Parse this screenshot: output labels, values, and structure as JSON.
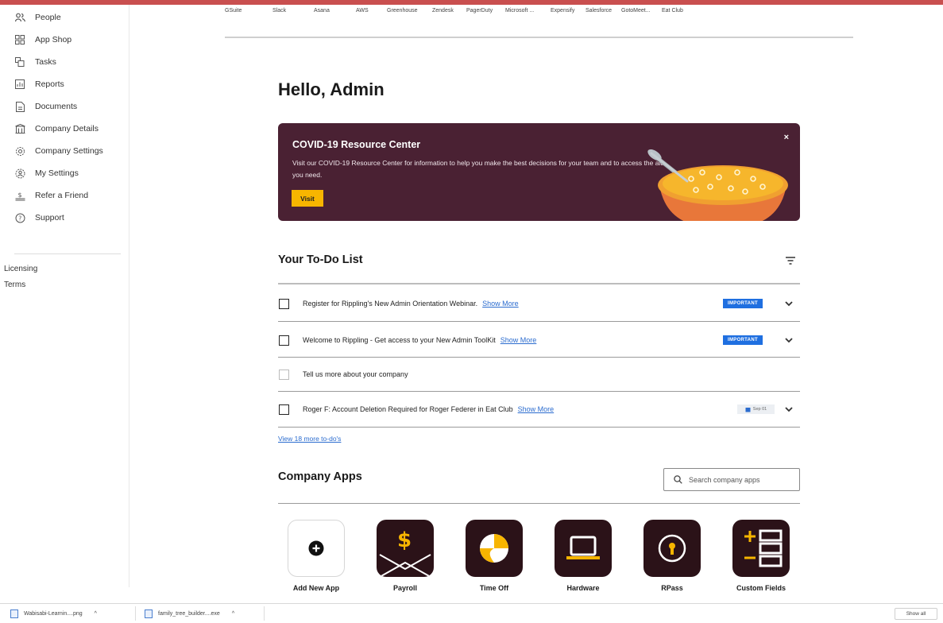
{
  "sidebar": {
    "items": [
      {
        "label": "People",
        "icon": "people-icon"
      },
      {
        "label": "App Shop",
        "icon": "grid-icon"
      },
      {
        "label": "Tasks",
        "icon": "tasks-icon"
      },
      {
        "label": "Reports",
        "icon": "reports-icon"
      },
      {
        "label": "Documents",
        "icon": "document-icon"
      },
      {
        "label": "Company Details",
        "icon": "building-icon"
      },
      {
        "label": "Company Settings",
        "icon": "gear-icon"
      },
      {
        "label": "My Settings",
        "icon": "user-gear-icon"
      },
      {
        "label": "Refer a Friend",
        "icon": "dollar-hand-icon"
      },
      {
        "label": "Support",
        "icon": "help-icon"
      }
    ],
    "footer_links": [
      "Licensing",
      "Terms"
    ]
  },
  "app_strip": [
    "GSuite",
    "Slack",
    "Asana",
    "AWS",
    "Greenhouse",
    "Zendesk",
    "PagerDuty",
    "Microsoft ...",
    "Expensify",
    "Salesforce",
    "GotoMeet...",
    "Eat Club"
  ],
  "greeting": "Hello, Admin",
  "banner": {
    "title": "COVID-19 Resource Center",
    "text": "Visit our COVID-19 Resource Center for information to help you make the best decisions for your team and to access the aid you need.",
    "button": "Visit",
    "close": "×",
    "background": "#4a2133",
    "button_color": "#f7b500"
  },
  "todo": {
    "title": "Your To-Do List",
    "items": [
      {
        "text": "Register for Rippling's New Admin Orientation Webinar.",
        "link": "Show More",
        "badge": "IMPORTANT"
      },
      {
        "text": "Welcome to Rippling - Get access to your New Admin ToolKit",
        "link": "Show More",
        "badge": "IMPORTANT"
      },
      {
        "text": "Tell us more about your company",
        "link": "",
        "badge": ""
      },
      {
        "text": "Roger F: Account Deletion Required for Roger Federer in Eat Club",
        "link": "Show More",
        "date": "Sep 01"
      }
    ],
    "view_more": "View 18 more to-do's"
  },
  "company_apps": {
    "title": "Company Apps",
    "search_placeholder": "Search company apps",
    "apps": [
      {
        "label": "Add New App",
        "icon": "plus-icon"
      },
      {
        "label": "Payroll",
        "icon": "payroll-icon"
      },
      {
        "label": "Time Off",
        "icon": "beach-ball-icon"
      },
      {
        "label": "Hardware",
        "icon": "laptop-icon"
      },
      {
        "label": "RPass",
        "icon": "keyhole-icon"
      },
      {
        "label": "Custom Fields",
        "icon": "custom-fields-icon"
      }
    ]
  },
  "downloads": {
    "items": [
      "Wabisabi-Learnin....png",
      "family_tree_builder....exe"
    ],
    "show_all": "Show all"
  },
  "colors": {
    "accent_link": "#2b6ccf",
    "badge_blue": "#1f6fe0",
    "top_accent": "#c94f4f"
  }
}
